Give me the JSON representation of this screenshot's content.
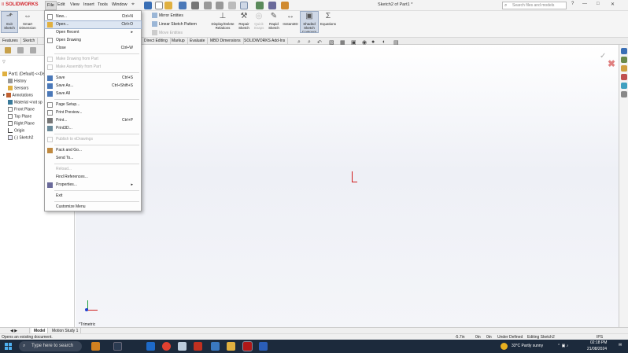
{
  "titlebar": {
    "logo": "SOLIDWORKS",
    "menus": [
      "File",
      "Edit",
      "View",
      "Insert",
      "Tools",
      "Window"
    ],
    "doc_title": "Sketch2 of Part1 *",
    "search_placeholder": "Search files and models",
    "help": "?"
  },
  "commands": {
    "exit_sketch": "Exit Sketch",
    "smart_dimension": "Smart Dimension",
    "mirror_entities": "Mirror Entities",
    "linear_pattern": "Linear Sketch Pattern",
    "move_entities": "Move Entities",
    "display_relations": "Display/Delete Relations",
    "repair_sketch": "Repair Sketch",
    "quick_snaps": "Quick Snaps",
    "rapid_sketch": "Rapid Sketch",
    "instant2d": "Instant2D",
    "shaded_contours": "Shaded Sketch Contours",
    "equations": "Equations"
  },
  "tabs": [
    "Features",
    "Sketch",
    "Direct Editing",
    "Markup",
    "Evaluate",
    "MBD Dimensions",
    "SOLIDWORKS Add-Ins"
  ],
  "tree": {
    "root": "Part1 (Default) <<De",
    "items": [
      "History",
      "Sensors",
      "Annotations",
      "Material <not sp",
      "Front Plane",
      "Top Plane",
      "Right Plane",
      "Origin",
      "(-) Sketch2"
    ]
  },
  "file_menu": {
    "new": "New...",
    "new_sc": "Ctrl+N",
    "open": "Open...",
    "open_sc": "Ctrl+O",
    "open_recent": "Open Recent",
    "open_drawing": "Open Drawing",
    "close": "Close",
    "close_sc": "Ctrl+W",
    "make_drawing": "Make Drawing from Part",
    "make_assembly": "Make Assembly from Part",
    "save": "Save",
    "save_sc": "Ctrl+S",
    "save_as": "Save As...",
    "save_as_sc": "Ctrl+Shift+S",
    "save_all": "Save All",
    "page_setup": "Page Setup...",
    "print_preview": "Print Preview...",
    "print": "Print...",
    "print_sc": "Ctrl+P",
    "print3d": "Print3D...",
    "publish": "Publish to eDrawings",
    "pack_and_go": "Pack and Go...",
    "send_to": "Send To...",
    "reload": "Reload...",
    "find_references": "Find References...",
    "properties": "Properties...",
    "exit": "Exit",
    "customize": "Customize Menu",
    "submenu_arrow": "▸"
  },
  "graphics": {
    "view_label": "*Trimetric"
  },
  "bottom_tabs": [
    "Model",
    "Motion Study 1"
  ],
  "status": {
    "hint": "Opens an existing document.",
    "x": "-5.7in",
    "y": "0in",
    "z": "0in",
    "state": "Under Defined",
    "editing": "Editing Sketch2",
    "units": "IPS"
  },
  "taskbar": {
    "search": "Type here to search",
    "weather": "33°C  Partly sunny",
    "time": "02:18 PM",
    "date": "21/08/2024"
  }
}
